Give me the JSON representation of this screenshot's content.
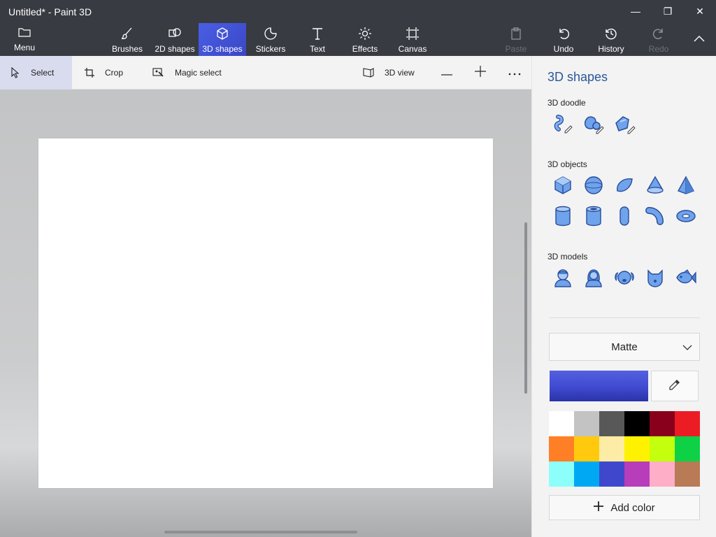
{
  "window": {
    "title": "Untitled* - Paint 3D",
    "minimize_glyph": "—",
    "restore_glyph": "❐",
    "close_glyph": "✕"
  },
  "ribbon": {
    "menu_label": "Menu",
    "items": [
      {
        "label": "Brushes",
        "icon": "brush-icon"
      },
      {
        "label": "2D shapes",
        "icon": "2d-shapes-icon"
      },
      {
        "label": "3D shapes",
        "icon": "cube-icon",
        "active": true
      },
      {
        "label": "Stickers",
        "icon": "sticker-icon"
      },
      {
        "label": "Text",
        "icon": "text-icon"
      },
      {
        "label": "Effects",
        "icon": "sun-icon"
      },
      {
        "label": "Canvas",
        "icon": "canvas-icon"
      }
    ],
    "paste_label": "Paste",
    "undo_label": "Undo",
    "history_label": "History",
    "redo_label": "Redo"
  },
  "toolbar": {
    "select_label": "Select",
    "crop_label": "Crop",
    "magic_select_label": "Magic select",
    "view_3d_label": "3D view"
  },
  "panel": {
    "title": "3D shapes",
    "doodle_heading": "3D doodle",
    "objects_heading": "3D objects",
    "models_heading": "3D models",
    "material": "Matte",
    "add_color_label": "Add color",
    "current_color": "#3f4ad0",
    "palette": [
      "#ffffff",
      "#c3c3c3",
      "#585858",
      "#000000",
      "#88001b",
      "#ec1c24",
      "#ff7f27",
      "#ffc90e",
      "#fdeca6",
      "#fff200",
      "#c4ff0e",
      "#0ed145",
      "#8cfffb",
      "#00a8f3",
      "#3f48cc",
      "#b83dba",
      "#ffaec8",
      "#b97a56"
    ]
  }
}
